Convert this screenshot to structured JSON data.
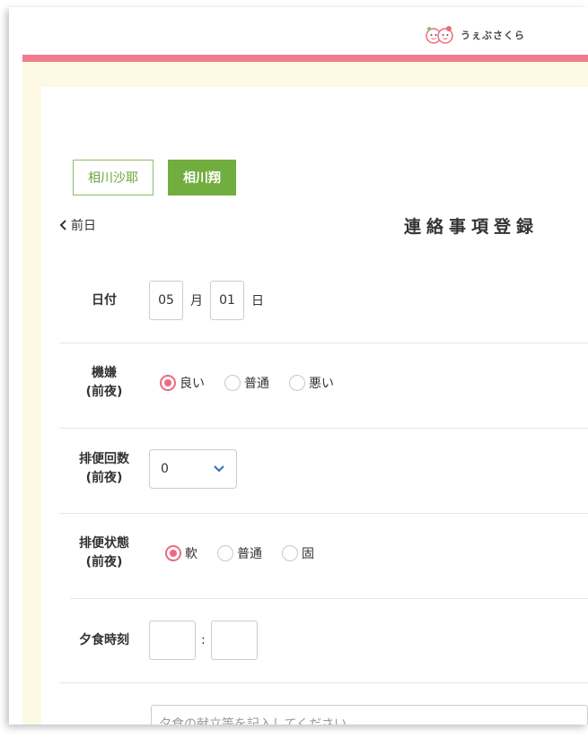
{
  "header": {
    "logo_text": "うぇぶさくら",
    "accent_color": "#f07c8e"
  },
  "children": [
    {
      "name": "相川沙耶",
      "active": false
    },
    {
      "name": "相川翔",
      "active": true
    }
  ],
  "nav": {
    "prev_label": "前日"
  },
  "page_title": "連絡事項登録",
  "form": {
    "date": {
      "label": "日付",
      "month": "05",
      "month_unit": "月",
      "day": "01",
      "day_unit": "日"
    },
    "mood": {
      "label_line1": "機嫌",
      "label_line2": "(前夜)",
      "options": [
        "良い",
        "普通",
        "悪い"
      ],
      "selected": "良い"
    },
    "bowel_count": {
      "label_line1": "排便回数",
      "label_line2": "(前夜)",
      "value": "0"
    },
    "bowel_state": {
      "label_line1": "排便状態",
      "label_line2": "(前夜)",
      "options": [
        "軟",
        "普通",
        "固"
      ],
      "selected": "軟"
    },
    "dinner_time": {
      "label": "夕食時刻",
      "separator": ":",
      "hour": "",
      "minute": ""
    },
    "dinner_menu": {
      "placeholder": "夕食の献立等を記入してください"
    }
  }
}
